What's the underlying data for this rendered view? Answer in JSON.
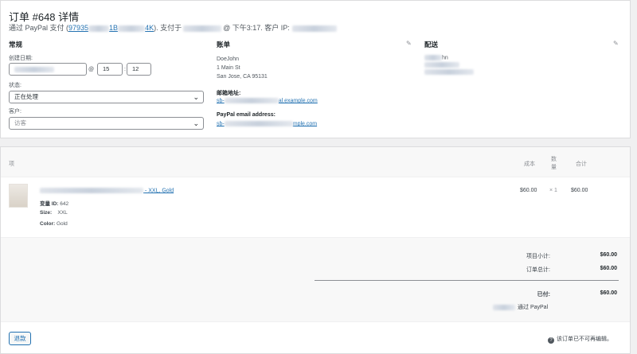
{
  "header": {
    "title": "订单 #648 详情",
    "sub_prefix": "通过 PayPal 支付 (",
    "txn_start": "97935",
    "txn_mid": "1B",
    "txn_end": "4K",
    "sub_mid": "). 支付于",
    "sub_at": "@ 下午3:17. 客户 IP:"
  },
  "general": {
    "heading": "常规",
    "created_label": "创建日期:",
    "at": "@",
    "hour": "15",
    "colon": ":",
    "minute": "12",
    "status_label": "状态:",
    "status_value": "正在处理",
    "customer_label": "客户:",
    "customer_value": "访客"
  },
  "billing": {
    "heading": "账单",
    "name": "DoeJohn",
    "street": "1 Main St",
    "city": "San Jose, CA 95131",
    "email_label": "邮箱地址:",
    "email_prefix": "sb-",
    "email_suffix": "al.example.com",
    "paypal_label": "PayPal email address:",
    "paypal_prefix": "sb-",
    "paypal_suffix": "mple.com"
  },
  "shipping": {
    "heading": "配送",
    "partial": "hn"
  },
  "items": {
    "col_item": "项",
    "col_cost": "成本",
    "col_qty_1": "数",
    "col_qty_2": "量",
    "col_total": "合计",
    "rows": [
      {
        "name_suffix": "- XXL, Gold",
        "variation_label": "变量 ID:",
        "variation_id": "642",
        "size_label": "Size:",
        "size_value": "XXL",
        "color_label": "Color:",
        "color_value": "Gold",
        "cost": "$60.00",
        "qty": "× 1",
        "total": "$60.00"
      }
    ]
  },
  "totals": {
    "subtotal_label": "项目小计:",
    "subtotal_value": "$60.00",
    "order_total_label": "订单总计:",
    "order_total_value": "$60.00",
    "paid_label": "已付:",
    "paid_value": "$60.00",
    "paid_via": "通过 PayPal"
  },
  "footer": {
    "refund_label": "退款",
    "note": "该订单已不可再编辑。"
  },
  "colors": {
    "accent": "#2271b1",
    "text": "#3c434a",
    "border": "#8c8f94"
  }
}
